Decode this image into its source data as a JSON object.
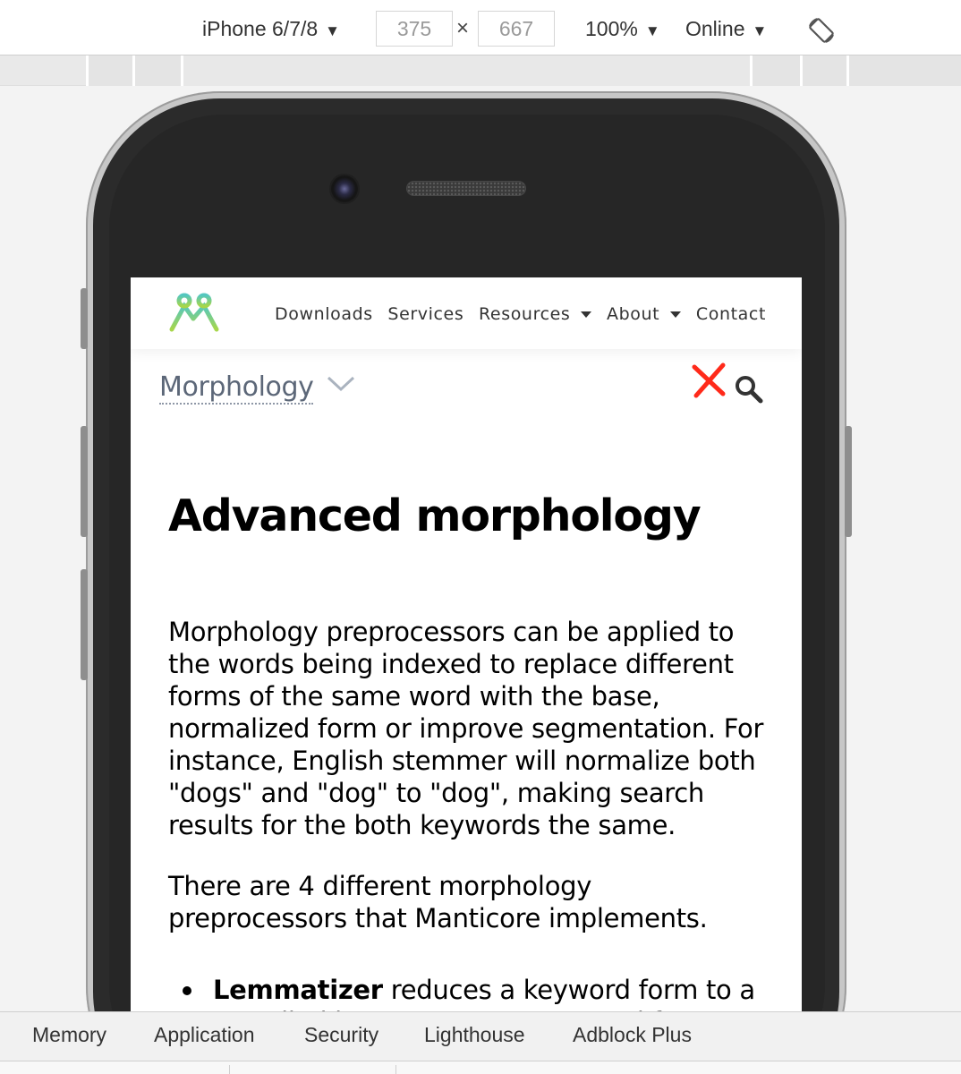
{
  "toolbar": {
    "device": "iPhone 6/7/8",
    "width": "375",
    "height": "667",
    "times_symbol": "×",
    "zoom": "100%",
    "network": "Online",
    "caret": "▼"
  },
  "site": {
    "nav": {
      "downloads": "Downloads",
      "services": "Services",
      "resources": "Resources",
      "about": "About",
      "contact": "Contact"
    },
    "section_select": "Morphology",
    "accent_color": "#ff2a1a"
  },
  "article": {
    "title": "Advanced morphology",
    "paragraph1": "Morphology preprocessors can be applied to the words being indexed to replace different forms of the same word with the base, normalized form or improve segmentation. For instance, English stemmer will normalize both \"dogs\" and \"dog\" to \"dog\", making search results for the both keywords the same.",
    "paragraph2": "There are 4 different morphology preprocessors that Manticore implements.",
    "bullet1_bold": "Lemmatizer",
    "bullet1_text": " reduces a keyword form to a so-called lemma, a proper normal form, or"
  },
  "devtools": {
    "tabs": [
      "Memory",
      "Application",
      "Security",
      "Lighthouse",
      "Adblock Plus"
    ]
  },
  "icons": [
    "rotate-icon",
    "logo-icon",
    "chevron-down-icon",
    "close-icon",
    "search-icon"
  ]
}
